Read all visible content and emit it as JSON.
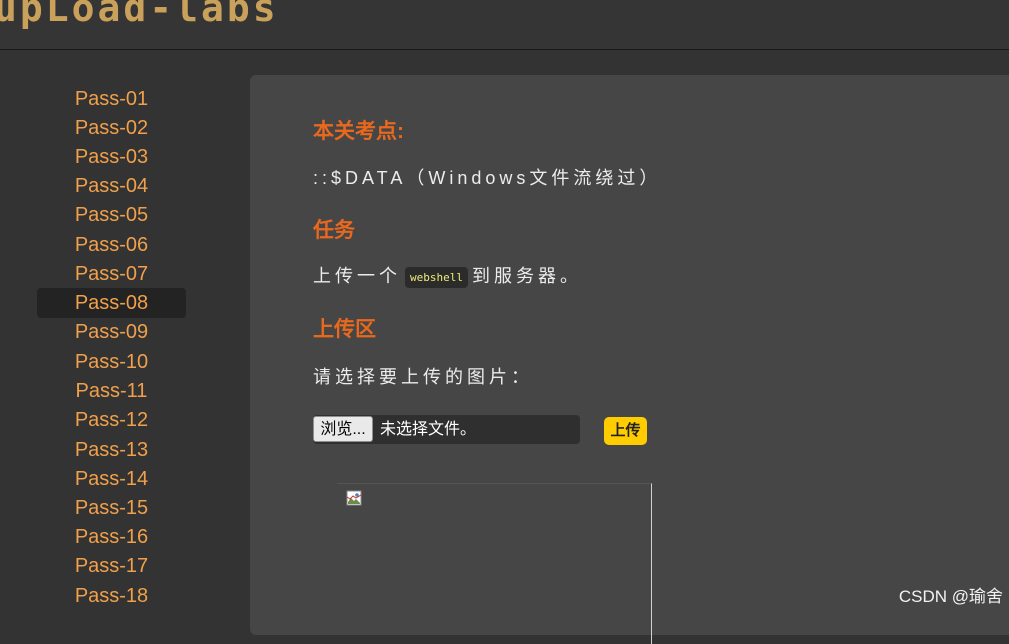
{
  "header": {
    "logo_text": "upLoad-labs"
  },
  "sidebar": {
    "items": [
      "Pass-01",
      "Pass-02",
      "Pass-03",
      "Pass-04",
      "Pass-05",
      "Pass-06",
      "Pass-07",
      "Pass-08",
      "Pass-09",
      "Pass-10",
      "Pass-11",
      "Pass-12",
      "Pass-13",
      "Pass-14",
      "Pass-15",
      "Pass-16",
      "Pass-17",
      "Pass-18"
    ],
    "active_item": "Pass-08"
  },
  "main": {
    "section1_title": "本关考点:",
    "section1_text": "::$DATA（Windows文件流绕过）",
    "section2_title": "任务",
    "task_prefix": "上传一个",
    "task_code": "webshell",
    "task_suffix": "到服务器。",
    "section3_title": "上传区",
    "upload_prompt": "请选择要上传的图片：",
    "browse_label": "浏览...",
    "no_file_text": "未选择文件。",
    "upload_label": "上传"
  },
  "preview": {
    "icon": "broken-image-icon"
  },
  "watermark": "CSDN @瑜舍",
  "colors": {
    "accent": "#e8681d",
    "nav_text": "#f0a04b",
    "upload_button": "#ffcc00",
    "panel": "#464646",
    "background": "#333333"
  }
}
